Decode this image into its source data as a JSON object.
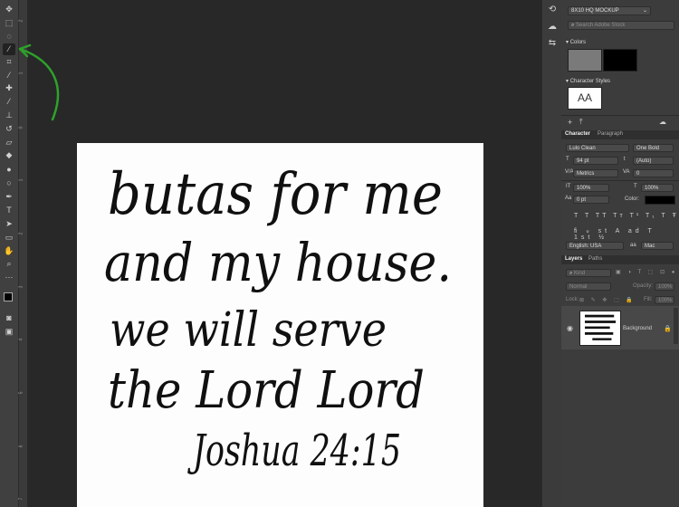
{
  "workspace": {
    "label": "8X10 HQ MOCKUP"
  },
  "search": {
    "placeholder": "Search Adobe Stock"
  },
  "panels": {
    "colors_title": "Colors",
    "swatch_colors": [
      "#7a7a7a",
      "#000000"
    ],
    "character_styles_title": "Character Styles",
    "style_preview": "AA"
  },
  "character": {
    "tabs": [
      "Character",
      "Paragraph"
    ],
    "font_family": "Lulo Clean",
    "font_style": "One Bold",
    "size": "94 pt",
    "leading": "(Auto)",
    "kerning": "Metrics",
    "tracking": "0",
    "vscale": "100%",
    "hscale": "100%",
    "baseline": "0 pt",
    "color_label": "Color:",
    "language": "English: USA",
    "aa": "Mac"
  },
  "layers": {
    "tabs": [
      "Layers",
      "Paths"
    ],
    "kind_placeholder": "Kind",
    "blend": "Normal",
    "opacity_label": "Opacity:",
    "opacity": "100%",
    "lock_label": "Lock:",
    "fill_label": "Fill:",
    "fill": "100%",
    "layer_name": "Background"
  },
  "document": {
    "lines": [
      "butas for me",
      "and my house.",
      "we will serve",
      "the Lord Lord",
      "Joshua 24:15"
    ]
  },
  "annotation": {
    "color": "#2ea22a"
  }
}
